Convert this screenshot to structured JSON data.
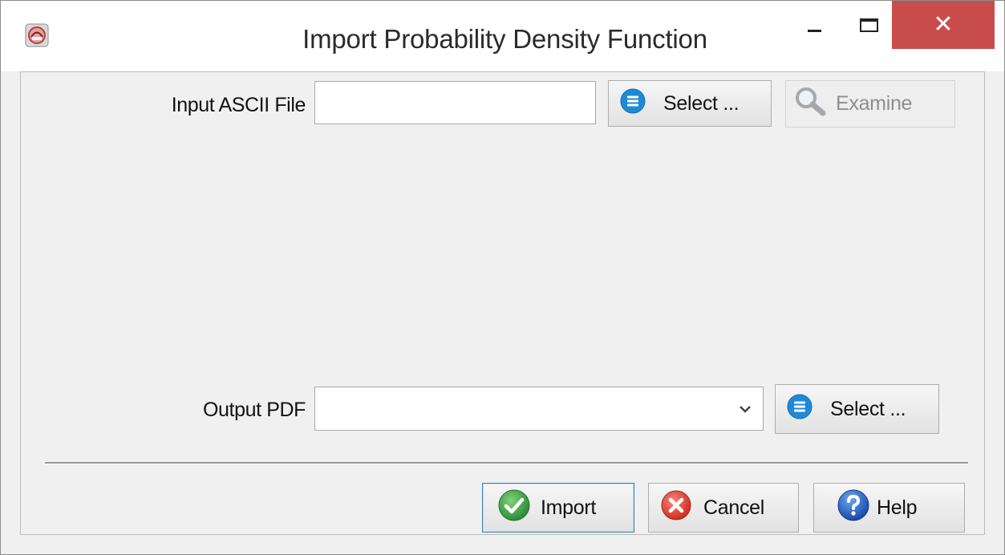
{
  "window": {
    "title": "Import Probability Density Function",
    "minimize_glyph": "",
    "close_glyph": "✕"
  },
  "input_section": {
    "label": "Input ASCII File",
    "value": "",
    "select_label": "Select ...",
    "examine_label": "Examine"
  },
  "output_section": {
    "label": "Output PDF",
    "value": "",
    "select_label": "Select ..."
  },
  "actions": {
    "import_label": "Import",
    "cancel_label": "Cancel",
    "help_label": "Help"
  },
  "icons": {
    "app": "app-logo-icon",
    "select": "list-icon",
    "examine": "magnifier-icon",
    "import": "checkmark-icon",
    "cancel": "cancel-x-icon",
    "help": "question-mark-icon",
    "dropdown": "chevron-down-icon"
  },
  "colors": {
    "close_button": "#c94c4c",
    "select_icon": "#1e8ad6",
    "import_icon": "#3aa14a",
    "cancel_icon": "#e0473b",
    "help_icon": "#1f63c2"
  }
}
